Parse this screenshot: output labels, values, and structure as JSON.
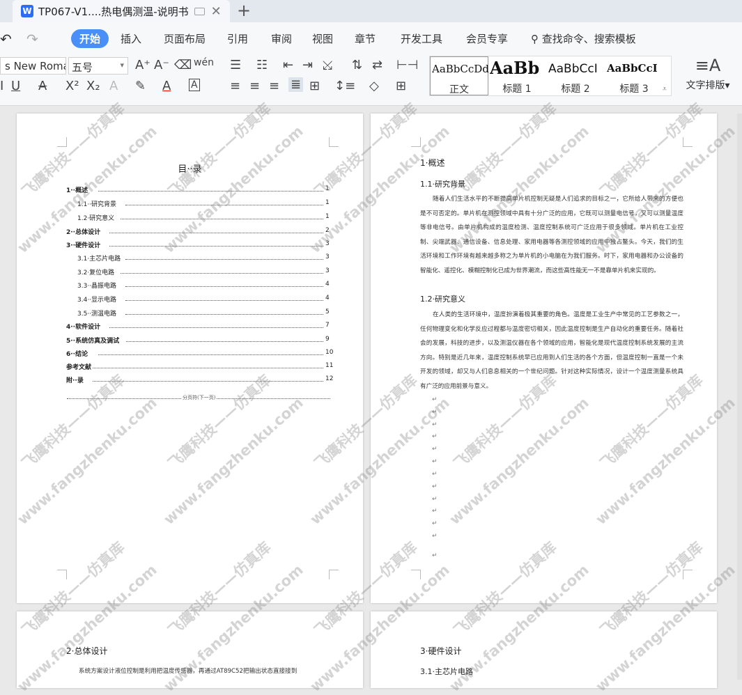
{
  "tab": {
    "title": "TP067-V1....热电偶测温-说明书",
    "app_icon": "W",
    "new_tab": "+"
  },
  "menu": {
    "items": [
      "开始",
      "插入",
      "页面布局",
      "引用",
      "审阅",
      "视图",
      "章节",
      "开发工具",
      "会员专享"
    ],
    "search": "查找命令、搜索模板"
  },
  "toolbar": {
    "font": "s New Roma",
    "size": "五号",
    "layout_label": "文字排版",
    "layout_arrow": "▾"
  },
  "styles": [
    {
      "sample": "AaBbCcDd",
      "name": "正文"
    },
    {
      "sample": "AaBb",
      "name": "标题 1"
    },
    {
      "sample": "AaBbCcI",
      "name": "标题 2"
    },
    {
      "sample": "AaBbCcI",
      "name": "标题 3"
    }
  ],
  "toc": {
    "title": "目··录",
    "items": [
      {
        "label": "1··概述",
        "page": "1"
      },
      {
        "label": "1.1··研究背景",
        "page": "1"
      },
      {
        "label": "1.2·研究意义",
        "page": "1"
      },
      {
        "label": "2··总体设计",
        "page": "2"
      },
      {
        "label": "3··硬件设计",
        "page": "3"
      },
      {
        "label": "3.1·主芯片电路",
        "page": "3"
      },
      {
        "label": "3.2·复位电路",
        "page": "3"
      },
      {
        "label": "3.3··晶振电路",
        "page": "4"
      },
      {
        "label": "3.4··显示电路",
        "page": "4"
      },
      {
        "label": "3.5··测温电路",
        "page": "5"
      },
      {
        "label": "4··软件设计",
        "page": "7"
      },
      {
        "label": "5··系统仿真及调试",
        "page": "9"
      },
      {
        "label": "6··结论",
        "page": "10"
      },
      {
        "label": "参考文献",
        "page": "11"
      },
      {
        "label": "附··录",
        "page": "12"
      }
    ],
    "section_break": "分页符(下一页)"
  },
  "page2": {
    "h1": "1·概述",
    "h2a": "1.1·研究背景",
    "p1": "随着人们生活水平的不断提高单片机控制无疑是人们追求的目标之一，它所给人带来的方便也是不可否定的。单片机在测控领域中具有十分广泛的应用，它既可以测量电信号，又可以测量温度等非电信号。由单片机构成的温度检测、温度控制系统可广泛应用于很多领域。单片机在工业控制、尖端武器、通信设备、信息处理、家用电器等各测控领域的应用中独占鳌头。今天，我们的生活环境和工作环境有越来越多称之为单片机的小电脑在为我们服务。时下，家用电器和办公设备的智能化、遥控化、模糊控制化已成为世界潮流，而这些高性能无一不是靠单片机来实现的。",
    "h2b": "1.2·研究意义",
    "p2": "在人类的生活环境中，温度扮演着极其重要的角色。温度是工业生产中常见的工艺参数之一，任何物理变化和化学反应过程都与温度密切相关，因此温度控制是生产自动化的重要任务。随着社会的发展，科技的进步，以及测温仪器在各个领域的应用，智能化是现代温度控制系统发展的主流方向。特别是近几年来，温度控制系统早已应用到人们生活的各个方面，但温度控制一直是一个未开发的领域，却又与人们息息相关的一个世纪问题。针对这种实际情况，设计一个温度测量系统具有广泛的应用前景与意义。"
  },
  "page3": {
    "h1": "2·总体设计",
    "p": "系统方案设计液位控制是利用把温度传感器，再通过AT89C52把输出状态直接接到"
  },
  "page4": {
    "h1": "3·硬件设计",
    "h2": "3.1·主芯片电路"
  },
  "watermark": {
    "text1": "飞鹰科技——仿真库",
    "text2": "www.fangzhenku.com"
  }
}
